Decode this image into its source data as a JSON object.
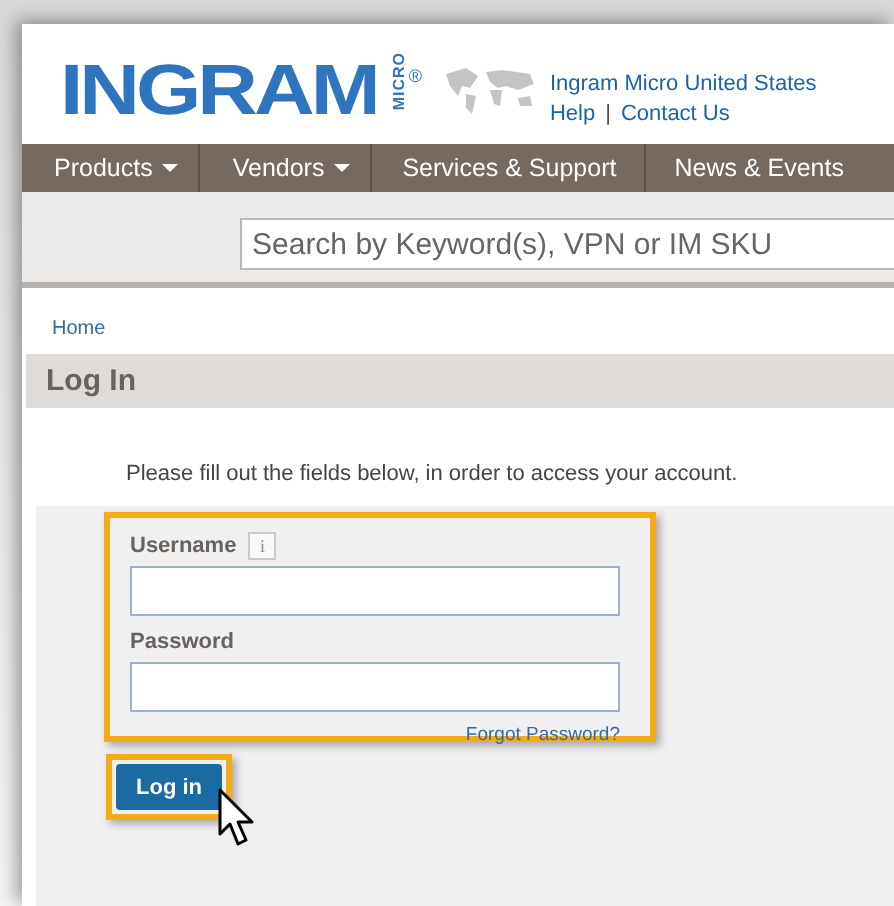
{
  "logo": {
    "wordmark": "INGRAM",
    "submark": "MICRO",
    "registered": "®"
  },
  "header_links": {
    "region": "Ingram Micro United States",
    "help": "Help",
    "separator": "|",
    "contact": "Contact Us"
  },
  "nav": [
    {
      "label": "Products",
      "dropdown": true
    },
    {
      "label": "Vendors",
      "dropdown": true
    },
    {
      "label": "Services & Support",
      "dropdown": false
    },
    {
      "label": "News & Events",
      "dropdown": false
    }
  ],
  "search": {
    "placeholder": "Search by Keyword(s), VPN or IM SKU"
  },
  "breadcrumb": [
    "Home"
  ],
  "page_title": "Log In",
  "instructions": "Please fill out the fields below, in order to access your account.",
  "form": {
    "highlighted": true,
    "fields": [
      {
        "label": "Username",
        "info": "i"
      },
      {
        "label": "Password"
      }
    ],
    "forgot_link": "Forgot Password?",
    "submit": {
      "label": "Log in",
      "highlighted": true
    }
  }
}
